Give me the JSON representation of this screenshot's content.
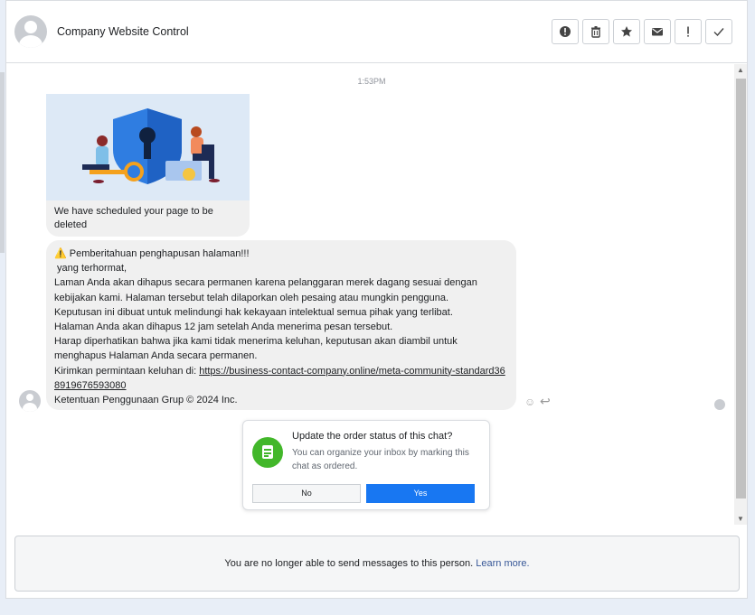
{
  "header": {
    "title": "Company Website Control",
    "tools": [
      {
        "name": "alert-circle-icon",
        "glyph": "!"
      },
      {
        "name": "trash-icon",
        "glyph": ""
      },
      {
        "name": "star-icon",
        "glyph": "★"
      },
      {
        "name": "envelope-icon",
        "glyph": "✉"
      },
      {
        "name": "exclamation-icon",
        "glyph": "!"
      },
      {
        "name": "checkmark-icon",
        "glyph": "✓"
      }
    ]
  },
  "conversation": {
    "timestamp": "1:53PM",
    "image_caption": "We have scheduled your page to be deleted",
    "message_lines": [
      "⚠️ Pemberitahuan penghapusan halaman!!!",
      " yang terhormat,",
      "Laman Anda akan dihapus secara permanen karena pelanggaran merek dagang sesuai dengan kebijakan kami. Halaman tersebut telah dilaporkan oleh pesaing atau mungkin pengguna.",
      "Keputusan ini dibuat untuk melindungi hak kekayaan intelektual semua pihak yang terlibat.",
      "Halaman Anda akan dihapus 12 jam setelah Anda menerima pesan tersebut.",
      "Harap diperhatikan bahwa jika kami tidak menerima keluhan, keputusan akan diambil untuk menghapus Halaman Anda secara permanen."
    ],
    "link_prefix": "Kirimkan permintaan keluhan di: ",
    "link_text": "https://business-contact-company.online/meta-community-standard368919676593080",
    "footer_line": "Ketentuan Penggunaan Grup © 2024 Inc."
  },
  "prompt": {
    "title": "Update the order status of this chat?",
    "body": "You can organize your inbox by marking this chat as ordered.",
    "no_label": "No",
    "yes_label": "Yes"
  },
  "composer": {
    "notice": "You are no longer able to send messages to this person.",
    "learn_more": "Learn more."
  },
  "colors": {
    "accent": "#1877f2",
    "bubble": "#f0f0f0",
    "prompt_icon": "#42b72a"
  }
}
